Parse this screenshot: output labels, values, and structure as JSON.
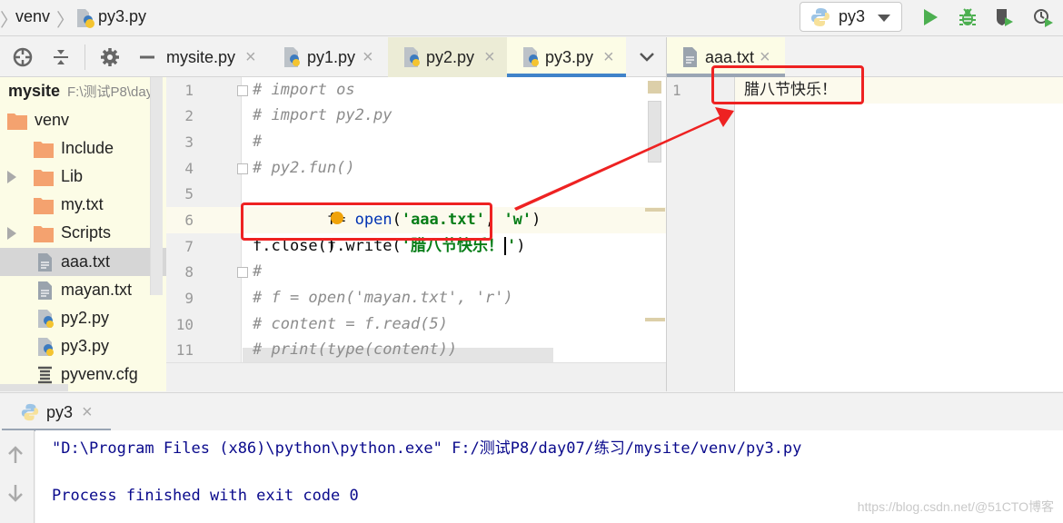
{
  "navbar": {
    "breadcrumbs": [
      "venv",
      "py3.py"
    ],
    "run_config": "py3"
  },
  "project": {
    "root_name": "mysite",
    "root_path": "F:\\测试P8\\day",
    "items": [
      {
        "label": "venv",
        "type": "folder",
        "level": 0,
        "expandable": false
      },
      {
        "label": "Include",
        "type": "folder",
        "level": 1,
        "expandable": false
      },
      {
        "label": "Lib",
        "type": "folder",
        "level": 1,
        "expandable": true
      },
      {
        "label": "my.txt",
        "type": "folder",
        "level": 1,
        "expandable": false
      },
      {
        "label": "Scripts",
        "type": "folder",
        "level": 1,
        "expandable": true
      },
      {
        "label": "aaa.txt",
        "type": "text",
        "level": 1,
        "selected": true
      },
      {
        "label": "mayan.txt",
        "type": "text",
        "level": 1
      },
      {
        "label": "py2.py",
        "type": "python",
        "level": 1
      },
      {
        "label": "py3.py",
        "type": "python",
        "level": 1
      },
      {
        "label": "pyvenv.cfg",
        "type": "config",
        "level": 1
      }
    ]
  },
  "editor_tabs": [
    {
      "label": "mysite.py",
      "icon": "none"
    },
    {
      "label": "py1.py",
      "icon": "python"
    },
    {
      "label": "py2.py",
      "icon": "python"
    },
    {
      "label": "py3.py",
      "icon": "python",
      "active": true
    }
  ],
  "editor": {
    "line_numbers": [
      "1",
      "2",
      "3",
      "4",
      "5",
      "6",
      "7",
      "8",
      "9",
      "10",
      "11"
    ],
    "lines": {
      "l1": "# import os",
      "l2": "# import py2.py",
      "l3": "#",
      "l4": "# py2.fun()",
      "l5_a": "f",
      "l5_b": "= ",
      "l5_c": "open",
      "l5_d": "(",
      "l5_e": "'aaa.txt'",
      "l5_f": ", ",
      "l5_g": "'w'",
      "l5_h": ")",
      "l6_a": "f.write(",
      "l6_b": "'",
      "l6_c": "腊八节快乐！",
      "l6_d": "'",
      "l6_e": ")",
      "l7": "f.close()",
      "l8": "#",
      "l9": "# f = open('mayan.txt', 'r')",
      "l10": "# content = f.read(5)",
      "l11": "# print(type(content))"
    }
  },
  "right_editor": {
    "tab_label": "aaa.txt",
    "line_number": "1",
    "content": "腊八节快乐！"
  },
  "run_panel": {
    "tab_label": "py3",
    "output": [
      "\"D:\\Program Files (x86)\\python\\python.exe\" F:/测试P8/day07/练习/mysite/venv/py3.py",
      "",
      "Process finished with exit code 0"
    ]
  },
  "watermark": "https://blog.csdn.net/@51CTO博客",
  "colors": {
    "annotation": "#ee2222",
    "active_tab_underline": "#4083c9",
    "run_green": "#4caf50"
  }
}
